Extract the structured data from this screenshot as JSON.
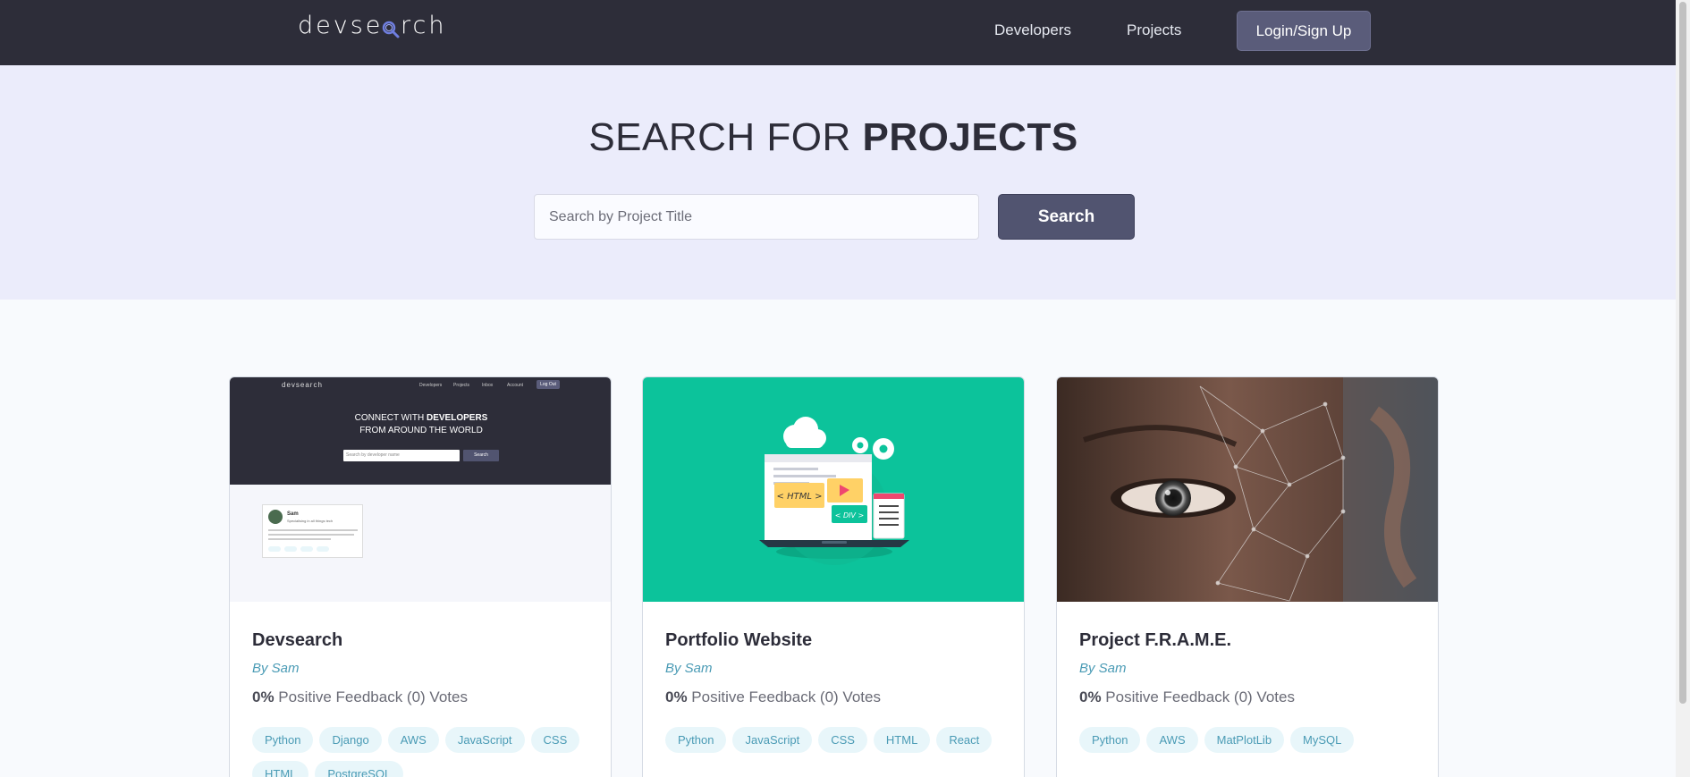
{
  "header": {
    "logo_prefix": "devse",
    "logo_mag": "a",
    "logo_suffix": "rch",
    "nav": [
      "Developers",
      "Projects"
    ],
    "login_label": "Login/Sign Up"
  },
  "hero": {
    "title_light": "SEARCH FOR ",
    "title_bold": "PROJECTS",
    "search_placeholder": "Search by Project Title",
    "search_button": "Search"
  },
  "projects": [
    {
      "title": "Devsearch",
      "author": "By Sam",
      "feedback_percent": "0%",
      "feedback_text": " Positive Feedback (0) Votes",
      "tags": [
        "Python",
        "Django",
        "AWS",
        "JavaScript",
        "CSS",
        "HTML",
        "PostgreSQL"
      ],
      "thumb": {
        "logo": "devsearch",
        "nav": [
          "Developers",
          "Projects",
          "Inbox",
          "Account"
        ],
        "logout": "Log Out",
        "headline_1": "CONNECT WITH ",
        "headline_bold": "DEVELOPERS",
        "headline_2": "FROM AROUND THE WORLD",
        "search_placeholder": "Search by developer name",
        "search_button": "Search",
        "profile_name": "Sam",
        "profile_subtitle": "Specialising in all things tech"
      }
    },
    {
      "title": "Portfolio Website",
      "author": "By Sam",
      "feedback_percent": "0%",
      "feedback_text": " Positive Feedback (0) Votes",
      "tags": [
        "Python",
        "JavaScript",
        "CSS",
        "HTML",
        "React"
      ],
      "thumb": {
        "html_label": "< HTML >",
        "div_label": "< DIV >"
      }
    },
    {
      "title": "Project F.R.A.M.E.",
      "author": "By Sam",
      "feedback_percent": "0%",
      "feedback_text": " Positive Feedback (0) Votes",
      "tags": [
        "Python",
        "AWS",
        "MatPlotLib",
        "MySQL"
      ]
    }
  ],
  "colors": {
    "header_bg": "#2d2d39",
    "hero_bg": "#ebecfb",
    "button_bg": "#515470",
    "accent": "#4a9bb5",
    "tag_bg": "#e8f6fa",
    "portfolio_thumb_bg": "#0cc39b"
  }
}
